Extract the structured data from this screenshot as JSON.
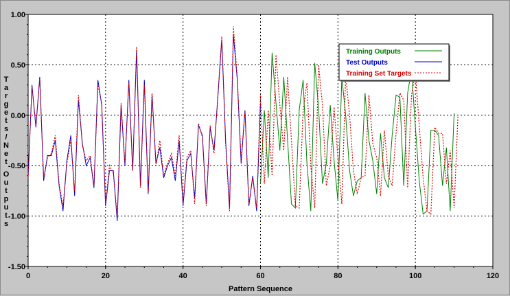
{
  "chart_data": {
    "type": "line",
    "title": "",
    "xlabel": "Pattern Sequence",
    "ylabel": "Targets/Net Outputs",
    "xlim": [
      0,
      120
    ],
    "ylim": [
      -1.5,
      1.0
    ],
    "x_ticks": [
      "0",
      "20",
      "40",
      "60",
      "80",
      "100",
      "120"
    ],
    "y_ticks": [
      "1.00",
      "0.50",
      "0.00",
      "-0.50",
      "-1.00",
      "-1.50"
    ],
    "grid": true,
    "legend_position": "top-right",
    "series": [
      {
        "name": "Training Outputs",
        "color": "#008000",
        "style": "solid",
        "x_start": 60,
        "values": [
          -0.68,
          0.05,
          -0.62,
          0.62,
          0.12,
          -0.35,
          0.38,
          -0.25,
          -0.88,
          -0.92,
          0.05,
          0.35,
          -0.48,
          -0.95,
          0.52,
          0.08,
          -0.68,
          -0.48,
          0.1,
          -0.45,
          -0.85,
          0.38,
          0.0,
          -0.55,
          -0.8,
          -0.65,
          -0.62,
          0.22,
          -0.25,
          -0.45,
          -0.78,
          -0.18,
          -0.62,
          -0.72,
          -0.2,
          0.2,
          0.18,
          -0.7,
          0.22,
          0.45,
          -0.12,
          -0.65,
          -0.98,
          -0.95,
          -0.15,
          -0.15,
          -0.2,
          -0.7,
          -0.32,
          -0.95,
          0.02
        ]
      },
      {
        "name": "Test Outputs",
        "color": "#0000cc",
        "style": "solid",
        "x_start": 0,
        "values": [
          -0.6,
          0.3,
          -0.12,
          0.38,
          -0.65,
          -0.4,
          -0.4,
          -0.25,
          -0.7,
          -0.95,
          -0.45,
          -0.2,
          -0.8,
          0.15,
          -0.28,
          -0.5,
          -0.42,
          -0.72,
          0.35,
          0.1,
          -0.9,
          -0.55,
          -0.55,
          -1.05,
          0.1,
          -0.5,
          0.35,
          -0.55,
          0.65,
          -0.7,
          0.35,
          -0.78,
          0.2,
          -0.48,
          -0.32,
          -0.62,
          -0.5,
          -0.42,
          -0.65,
          -0.25,
          -0.9,
          -0.45,
          -0.38,
          -0.82,
          -0.1,
          -0.2,
          -0.88,
          -0.12,
          -0.35,
          0.18,
          0.75,
          -0.25,
          -0.92,
          0.8,
          0.35,
          -0.48,
          0.05,
          -0.9,
          -0.6,
          -0.95,
          0.12
        ]
      },
      {
        "name": "Training Set Targets",
        "color": "#dd0000",
        "style": "dotted",
        "x_start": 0,
        "values": [
          -0.62,
          0.28,
          -0.1,
          0.36,
          -0.62,
          -0.42,
          -0.38,
          -0.2,
          -0.68,
          -0.9,
          -0.48,
          -0.25,
          -0.75,
          0.2,
          -0.3,
          -0.45,
          -0.4,
          -0.7,
          0.3,
          0.12,
          -0.88,
          -0.5,
          -0.58,
          -1.0,
          0.12,
          -0.48,
          0.32,
          -0.55,
          0.68,
          -0.72,
          0.3,
          -0.78,
          0.22,
          -0.5,
          -0.25,
          -0.6,
          -0.48,
          -0.38,
          -0.6,
          -0.2,
          -0.88,
          -0.42,
          -0.35,
          -0.88,
          -0.08,
          -0.22,
          -0.9,
          -0.1,
          -0.38,
          0.2,
          0.78,
          -0.28,
          -0.95,
          0.88,
          0.38,
          -0.45,
          0.05,
          -0.88,
          -0.62,
          -0.92,
          0.2,
          -0.68,
          0.05,
          -0.6,
          0.6,
          0.1,
          -0.35,
          0.38,
          -0.25,
          -0.9,
          -0.92,
          0.05,
          0.32,
          -0.5,
          -0.92,
          0.5,
          0.1,
          -0.7,
          -0.5,
          0.08,
          -0.42,
          -0.88,
          0.4,
          0.0,
          -0.55,
          -0.78,
          -0.62,
          -0.6,
          0.2,
          -0.28,
          -0.42,
          -0.8,
          -0.15,
          -0.6,
          -0.7,
          -0.18,
          0.22,
          0.15,
          -0.72,
          0.2,
          0.42,
          -0.1,
          -0.62,
          -0.95,
          -0.98,
          -0.12,
          -0.18,
          -0.18,
          -0.68,
          -0.35,
          -0.92,
          0.0
        ]
      }
    ]
  }
}
